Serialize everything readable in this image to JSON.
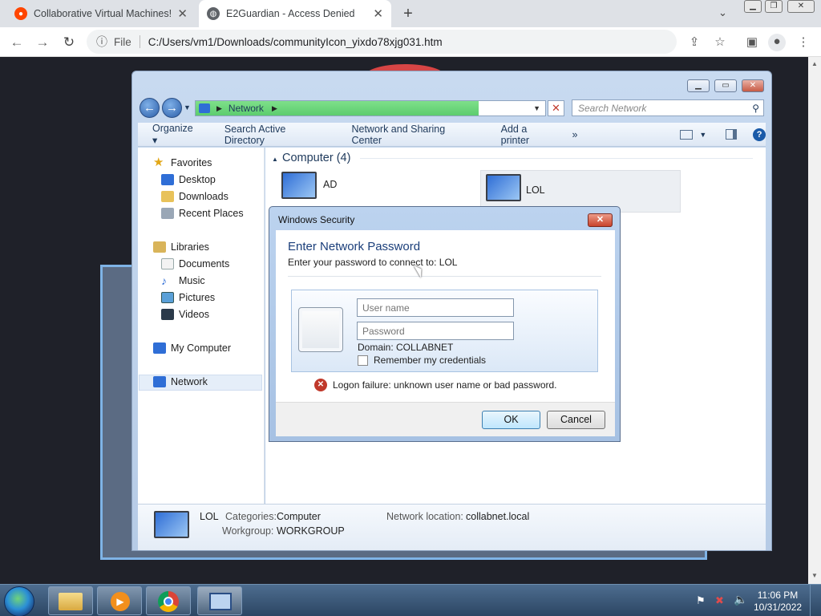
{
  "browser": {
    "tabs": [
      {
        "title": "Collaborative Virtual Machines!",
        "icon": "reddit-icon"
      },
      {
        "title": "E2Guardian - Access Denied",
        "icon": "globe-icon"
      }
    ],
    "url_scheme_label": "File",
    "url": "C:/Users/vm1/Downloads/communityIcon_yixdo78xjg031.htm"
  },
  "explorer": {
    "breadcrumb": "Network",
    "search_placeholder": "Search Network",
    "commands": [
      "Organize ▾",
      "Search Active Directory",
      "Network and Sharing Center",
      "Add a printer",
      "»"
    ],
    "nav": {
      "favorites": "Favorites",
      "favorites_items": [
        "Desktop",
        "Downloads",
        "Recent Places"
      ],
      "libraries": "Libraries",
      "libraries_items": [
        "Documents",
        "Music",
        "Pictures",
        "Videos"
      ],
      "computer": "My Computer",
      "network": "Network"
    },
    "group_header": "Computer (4)",
    "computers": [
      "AD",
      "LOL"
    ],
    "details": {
      "name": "LOL",
      "categories_label": "Categories:",
      "categories_value": "Computer",
      "workgroup_label": "Workgroup:",
      "workgroup_value": "WORKGROUP",
      "netloc_label": "Network location:",
      "netloc_value": "collabnet.local"
    }
  },
  "dialog": {
    "title": "Windows Security",
    "heading": "Enter Network Password",
    "subheading": "Enter your password to connect to: LOL",
    "username_placeholder": "User name",
    "password_placeholder": "Password",
    "domain": "Domain: COLLABNET",
    "remember": "Remember my credentials",
    "error": "Logon failure: unknown user name or bad password.",
    "ok": "OK",
    "cancel": "Cancel"
  },
  "taskbar": {
    "time": "11:06 PM",
    "date": "10/31/2022"
  },
  "colors": {
    "accent_blue": "#1a5aa8",
    "error_red": "#c0392b",
    "address_progress": "#5ccc6e"
  }
}
